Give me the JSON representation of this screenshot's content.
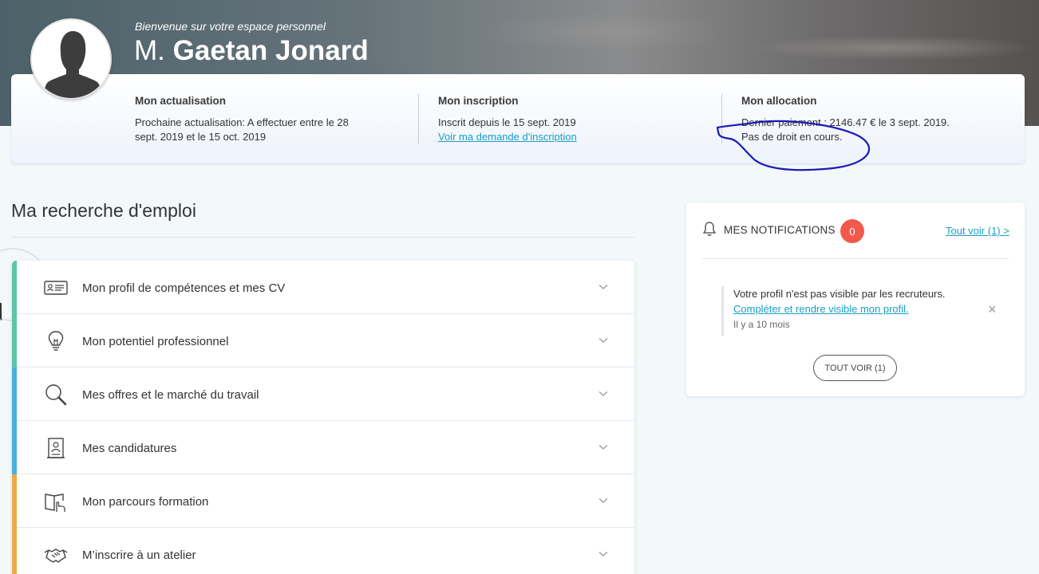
{
  "header": {
    "welcome": "Bienvenue sur votre espace personnel",
    "civility": "M.",
    "name": "Gaetan Jonard",
    "avatar_icon": "user-silhouette-icon"
  },
  "info": {
    "actualisation": {
      "title": "Mon actualisation",
      "text": "Prochaine actualisation: A effectuer entre le 28 sept. 2019 et le 15 oct. 2019"
    },
    "inscription": {
      "title": "Mon inscription",
      "text": "Inscrit depuis le 15 sept. 2019",
      "link": "Voir ma demande d'inscription"
    },
    "allocation": {
      "title": "Mon allocation",
      "line1": "Dernier paiement : 2146.47 € le 3 sept. 2019.",
      "line2": "Pas de droit en cours."
    }
  },
  "job_search": {
    "title": "Ma recherche d'emploi",
    "items": [
      {
        "label": "Mon profil de compétences et mes CV",
        "icon": "id-card-icon",
        "color": "#5ac8a8"
      },
      {
        "label": "Mon potentiel professionnel",
        "icon": "lightbulb-icon",
        "color": "#5ac8a8"
      },
      {
        "label": "Mes offres et le marché du travail",
        "icon": "search-icon",
        "color": "#4aaede"
      },
      {
        "label": "Mes candidatures",
        "icon": "application-icon",
        "color": "#4aaede"
      },
      {
        "label": "Mon parcours formation",
        "icon": "book-touch-icon",
        "color": "#ecab4a"
      },
      {
        "label": "M’inscrire à un atelier",
        "icon": "handshake-icon",
        "color": "#ecab4a"
      }
    ]
  },
  "notifications": {
    "title": "MES NOTIFICATIONS",
    "count": "0",
    "see_all": "Tout voir (1) >",
    "entry": {
      "text": "Votre profil n'est pas visible par les recruteurs.",
      "link": "Compléter et rendre visible mon profil.",
      "time": "Il y a 10 mois",
      "close": "×"
    },
    "button": "TOUT VOIR (1)"
  },
  "colors": {
    "link": "#1a9ec4",
    "badge": "#f2594b",
    "annotation": "#1a1ab8"
  }
}
